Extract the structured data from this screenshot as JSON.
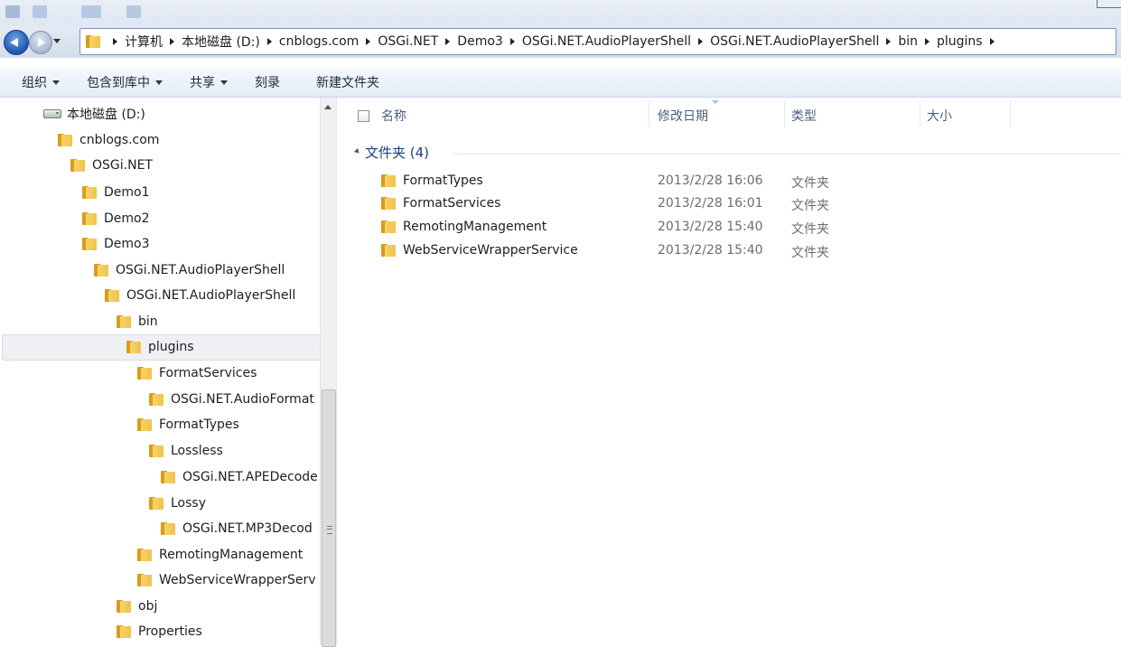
{
  "address": {
    "breadcrumb": [
      "计算机",
      "本地磁盘 (D:)",
      "cnblogs.com",
      "OSGi.NET",
      "Demo3",
      "OSGi.NET.AudioPlayerShell",
      "OSGi.NET.AudioPlayerShell",
      "bin",
      "plugins"
    ]
  },
  "toolbar": {
    "organize": "组织",
    "include_library": "包含到库中",
    "share": "共享",
    "burn": "刻录",
    "new_folder": "新建文件夹"
  },
  "tree": [
    {
      "label": "本地磁盘 (D:)",
      "icon": "drive-icon"
    },
    {
      "label": "cnblogs.com",
      "icon": "folder-icon"
    },
    {
      "label": "OSGi.NET",
      "icon": "folder-icon"
    },
    {
      "label": "Demo1",
      "icon": "folder-icon"
    },
    {
      "label": "Demo2",
      "icon": "folder-icon"
    },
    {
      "label": "Demo3",
      "icon": "folder-icon"
    },
    {
      "label": "OSGi.NET.AudioPlayerShell",
      "icon": "folder-icon"
    },
    {
      "label": "OSGi.NET.AudioPlayerShell",
      "icon": "folder-icon"
    },
    {
      "label": "bin",
      "icon": "folder-icon"
    },
    {
      "label": "plugins",
      "icon": "folder-icon",
      "selected": true
    },
    {
      "label": "FormatServices",
      "icon": "folder-icon"
    },
    {
      "label": "OSGi.NET.AudioFormat",
      "icon": "folder-icon"
    },
    {
      "label": "FormatTypes",
      "icon": "folder-icon"
    },
    {
      "label": "Lossless",
      "icon": "folder-icon"
    },
    {
      "label": "OSGi.NET.APEDecode",
      "icon": "folder-icon"
    },
    {
      "label": "Lossy",
      "icon": "folder-icon"
    },
    {
      "label": "OSGi.NET.MP3Decod",
      "icon": "folder-icon"
    },
    {
      "label": "RemotingManagement",
      "icon": "folder-icon"
    },
    {
      "label": "WebServiceWrapperServ",
      "icon": "folder-icon"
    },
    {
      "label": "obj",
      "icon": "folder-icon"
    },
    {
      "label": "Properties",
      "icon": "folder-icon"
    }
  ],
  "columns": {
    "name": "名称",
    "date": "修改日期",
    "type": "类型",
    "size": "大小"
  },
  "group": {
    "label": "文件夹 (4)"
  },
  "files": [
    {
      "name": "FormatTypes",
      "date": "2013/2/28 16:06",
      "type": "文件夹"
    },
    {
      "name": "FormatServices",
      "date": "2013/2/28 16:01",
      "type": "文件夹"
    },
    {
      "name": "RemotingManagement",
      "date": "2013/2/28 15:40",
      "type": "文件夹"
    },
    {
      "name": "WebServiceWrapperService",
      "date": "2013/2/28 15:40",
      "type": "文件夹"
    }
  ],
  "colors": {
    "selection_bg": "#eef0f3",
    "group_text": "#1e3e8c",
    "header_text": "#4c607a"
  }
}
